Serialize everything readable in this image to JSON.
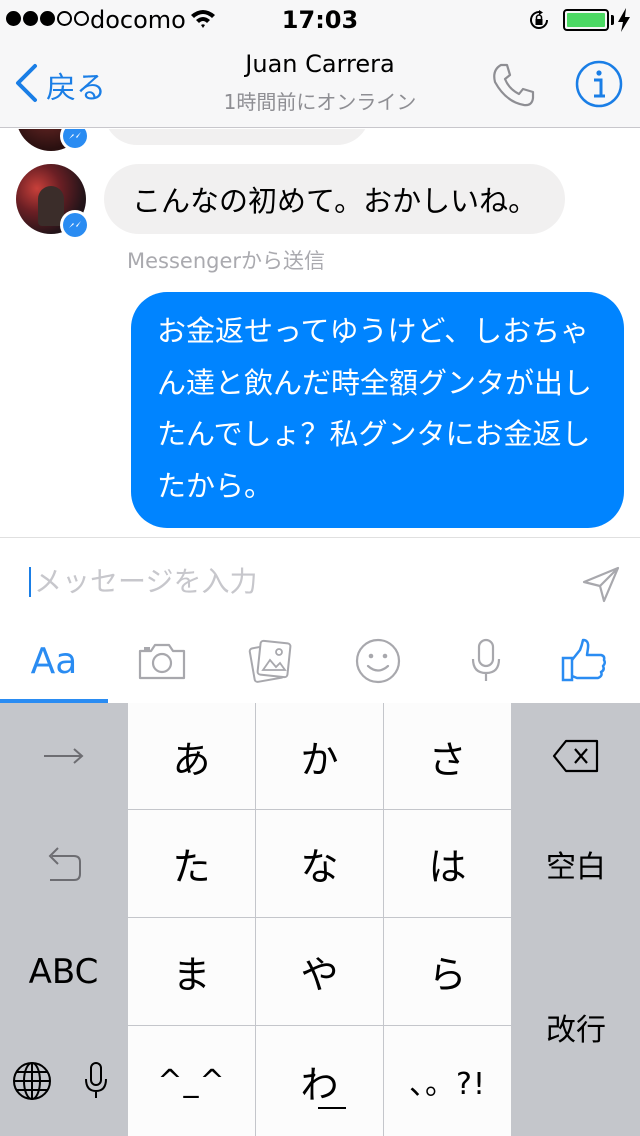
{
  "status_bar": {
    "carrier": "docomo",
    "time": "17:03",
    "battery_color": "#4cd964"
  },
  "nav": {
    "back_label": "戻る",
    "title": "Juan Carrera",
    "subtitle": "1時間前にオンライン",
    "accent_color": "#1a7ee6",
    "icons": [
      "chevron-left-icon",
      "phone-icon",
      "info-icon"
    ]
  },
  "messages": [
    {
      "direction": "incoming",
      "text": "こんなの初めて。おかしいね。",
      "footer": "Messengerから送信"
    },
    {
      "direction": "outgoing",
      "text": "お金返せってゆうけど、しおちゃん達と飲んだ時全額グンタが出したんでしょ？私グンタにお金返したから。"
    }
  ],
  "composer": {
    "placeholder": "メッセージを入力",
    "value": ""
  },
  "tools": {
    "text_mode_label": "Aa",
    "icons": [
      "camera-icon",
      "gallery-icon",
      "emoji-icon",
      "microphone-icon",
      "like-icon"
    ]
  },
  "keyboard": {
    "row1": {
      "left": "arrow-right-icon",
      "keys": [
        "あ",
        "か",
        "さ"
      ],
      "right": "delete-icon"
    },
    "row2": {
      "left": "undo-icon",
      "keys": [
        "た",
        "な",
        "は"
      ],
      "right": "空白"
    },
    "row3": {
      "left": "ABC",
      "keys": [
        "ま",
        "や",
        "ら"
      ],
      "right": "改行"
    },
    "row4": {
      "left": [
        "globe-icon",
        "microphone-icon"
      ],
      "keys": [
        "^_^",
        "わ",
        "、。?!"
      ]
    }
  },
  "colors": {
    "outgoing_bubble": "#0084ff",
    "incoming_bubble": "#f1f0f0",
    "keyboard_bg": "#c4c6cb"
  }
}
